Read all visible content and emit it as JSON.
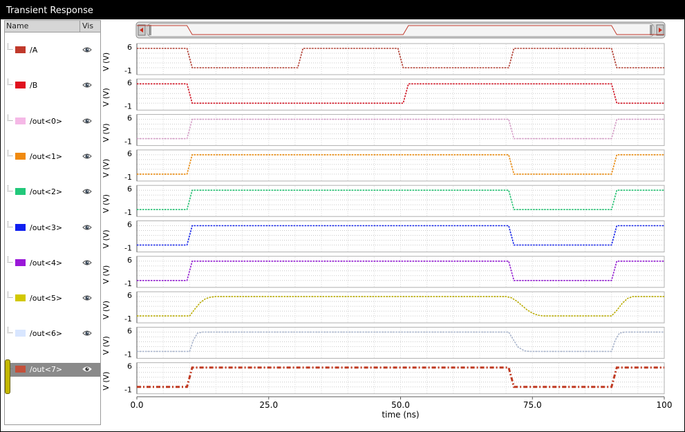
{
  "window": {
    "title": "Transient Response"
  },
  "sidebar": {
    "name_header": "Name",
    "vis_header": "Vis",
    "signals": [
      {
        "label": "/A",
        "color": "#c0392b",
        "selected": false
      },
      {
        "label": "/B",
        "color": "#e0101e",
        "selected": false
      },
      {
        "label": "/out<0>",
        "color": "#f5b8e6",
        "selected": false
      },
      {
        "label": "/out<1>",
        "color": "#f08a10",
        "selected": false
      },
      {
        "label": "/out<2>",
        "color": "#22c87a",
        "selected": false
      },
      {
        "label": "/out<3>",
        "color": "#1020f0",
        "selected": false
      },
      {
        "label": "/out<4>",
        "color": "#9a18d8",
        "selected": false
      },
      {
        "label": "/out<5>",
        "color": "#d2c800",
        "selected": false
      },
      {
        "label": "/out<6>",
        "color": "#d8e6ff",
        "selected": true
      },
      {
        "label": "/out<7>",
        "color": "#c4503a",
        "selected": true
      }
    ]
  },
  "chart_data": {
    "type": "line",
    "xlabel": "time (ns)",
    "ylabel": "V (V)",
    "xlim": [
      0,
      100
    ],
    "ylim": [
      -1,
      6
    ],
    "x_ticks": [
      "0.0",
      "25.0",
      "50.0",
      "75.0",
      "100"
    ],
    "y_tick_labels": [
      "6",
      "-1"
    ],
    "grid": true,
    "series": [
      {
        "name": "/A",
        "color": "#b03a2e",
        "points": [
          [
            0,
            6
          ],
          [
            9.5,
            6
          ],
          [
            10.5,
            -1
          ],
          [
            30.5,
            -1
          ],
          [
            31.5,
            6
          ],
          [
            49.5,
            6
          ],
          [
            50.5,
            -1
          ],
          [
            70.5,
            -1
          ],
          [
            71.5,
            6
          ],
          [
            90,
            6
          ],
          [
            91,
            -1
          ],
          [
            100,
            -1
          ]
        ]
      },
      {
        "name": "/B",
        "color": "#d01020",
        "points": [
          [
            0,
            6
          ],
          [
            9.5,
            6
          ],
          [
            10.5,
            -1
          ],
          [
            50.5,
            -1
          ],
          [
            51.5,
            6
          ],
          [
            90,
            6
          ],
          [
            91,
            -1
          ],
          [
            100,
            -1
          ]
        ]
      },
      {
        "name": "/out<0>",
        "color": "#d49cc6",
        "points": [
          [
            0,
            -1
          ],
          [
            9.5,
            -1
          ],
          [
            10.5,
            6
          ],
          [
            70.5,
            6
          ],
          [
            71.5,
            -1
          ],
          [
            90,
            -1
          ],
          [
            91,
            6
          ],
          [
            100,
            6
          ]
        ]
      },
      {
        "name": "/out<1>",
        "color": "#e8880a",
        "points": [
          [
            0,
            -1
          ],
          [
            9.5,
            -1
          ],
          [
            10.5,
            6
          ],
          [
            70.5,
            6
          ],
          [
            71.5,
            -1
          ],
          [
            90,
            -1
          ],
          [
            91,
            6
          ],
          [
            100,
            6
          ]
        ]
      },
      {
        "name": "/out<2>",
        "color": "#20c070",
        "points": [
          [
            0,
            -1
          ],
          [
            9.5,
            -1
          ],
          [
            10.5,
            6
          ],
          [
            70.5,
            6
          ],
          [
            71.5,
            -1
          ],
          [
            90,
            -1
          ],
          [
            91,
            6
          ],
          [
            100,
            6
          ]
        ]
      },
      {
        "name": "/out<3>",
        "color": "#1020e8",
        "points": [
          [
            0,
            -1
          ],
          [
            9.5,
            -1
          ],
          [
            10.5,
            6
          ],
          [
            70.5,
            6
          ],
          [
            71.5,
            -1
          ],
          [
            90,
            -1
          ],
          [
            91,
            6
          ],
          [
            100,
            6
          ]
        ]
      },
      {
        "name": "/out<4>",
        "color": "#9018d0",
        "points": [
          [
            0,
            -1
          ],
          [
            9.5,
            -1
          ],
          [
            10.5,
            6
          ],
          [
            70.5,
            6
          ],
          [
            71.5,
            -1
          ],
          [
            90,
            -1
          ],
          [
            91,
            6
          ],
          [
            100,
            6
          ]
        ]
      },
      {
        "name": "/out<5>",
        "color": "#b8aa00",
        "points": [
          [
            0,
            -1
          ],
          [
            10,
            -1
          ],
          [
            11,
            1.5
          ],
          [
            12,
            3.8
          ],
          [
            13,
            5.2
          ],
          [
            14,
            5.8
          ],
          [
            15,
            6
          ],
          [
            70,
            6
          ],
          [
            71,
            5.6
          ],
          [
            72,
            4.4
          ],
          [
            73,
            2.8
          ],
          [
            74,
            1.2
          ],
          [
            75,
            0
          ],
          [
            76,
            -0.7
          ],
          [
            77,
            -1
          ],
          [
            90,
            -1
          ],
          [
            91,
            1
          ],
          [
            92,
            3.5
          ],
          [
            93,
            5.3
          ],
          [
            94,
            6
          ],
          [
            100,
            6
          ]
        ]
      },
      {
        "name": "/out<6>",
        "color": "#a8b4cc",
        "points": [
          [
            0,
            -1
          ],
          [
            10,
            -1
          ],
          [
            10.7,
            3
          ],
          [
            11.5,
            5.6
          ],
          [
            12.5,
            6
          ],
          [
            70.5,
            6
          ],
          [
            71.3,
            3.5
          ],
          [
            72.3,
            0.5
          ],
          [
            73.5,
            -0.8
          ],
          [
            74.5,
            -1
          ],
          [
            90,
            -1
          ],
          [
            90.7,
            3
          ],
          [
            91.5,
            5.6
          ],
          [
            92.5,
            6
          ],
          [
            100,
            6
          ]
        ]
      },
      {
        "name": "/out<7>",
        "color": "#c03a22",
        "points": [
          [
            0,
            -1
          ],
          [
            9.5,
            -1
          ],
          [
            10.5,
            6
          ],
          [
            70.5,
            6
          ],
          [
            71.5,
            -1
          ],
          [
            90,
            -1
          ],
          [
            91,
            6
          ],
          [
            100,
            6
          ]
        ]
      }
    ]
  }
}
